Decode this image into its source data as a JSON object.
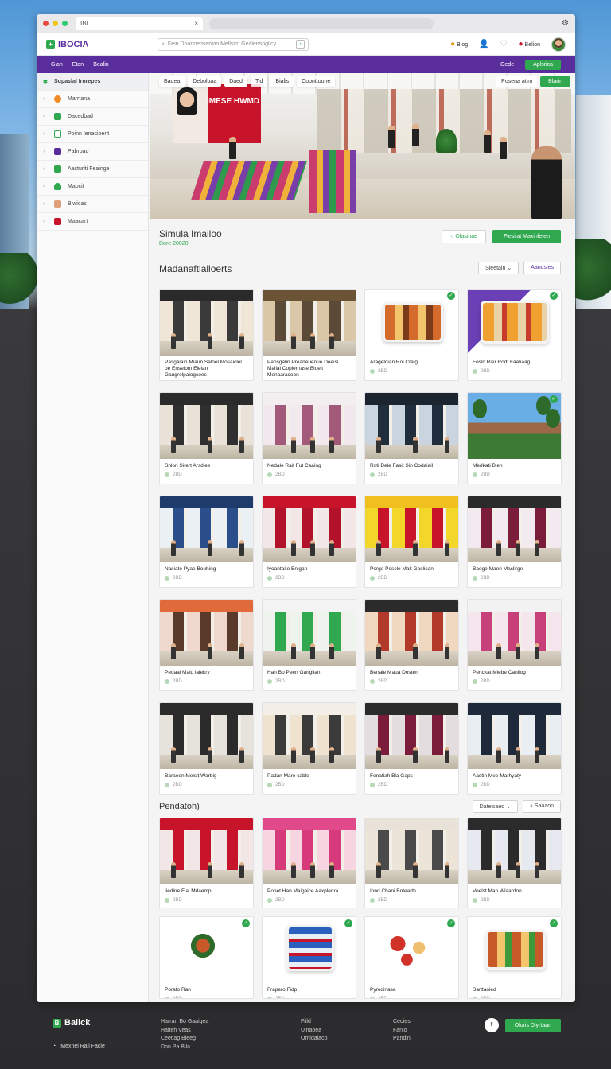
{
  "browser": {
    "tab_label": "IBl",
    "tab_close": "×",
    "settings_glyph": "⚙"
  },
  "appbar": {
    "logo": "IBOCIA",
    "search_placeholder": "Fein Dhanrienserwin Mellsirn Gealensnglicy",
    "user_name_1": "Blog",
    "user_name_2": "Belion"
  },
  "navbar": {
    "items": [
      "Gian",
      "Etan",
      "Bealin"
    ],
    "right_label": "Gede",
    "right_button": "Aplsrica"
  },
  "sidebar": {
    "items": [
      {
        "label": "Supaslal Irnrepes",
        "color": "#2fa84f"
      },
      {
        "label": "Marrtana",
        "color": "#f08a24"
      },
      {
        "label": "Dacedbad",
        "color": "#2fa84f"
      },
      {
        "label": "Poinn Ienacioent",
        "color": "#2fa84f"
      },
      {
        "label": "Pabroad",
        "color": "#5a2d9c"
      },
      {
        "label": "Aacturiti Feainge",
        "color": "#2fa84f"
      },
      {
        "label": "Maocit",
        "color": "#2fa84f"
      },
      {
        "label": "Biwicas",
        "color": "#c8142b"
      },
      {
        "label": "Maacart",
        "color": "#c8142b"
      }
    ]
  },
  "hero": {
    "tabs": [
      "Badea",
      "Debolbaa",
      "Daed",
      "Tid",
      "Bialis",
      "Coonttoone"
    ],
    "right_chip": "Posena atim",
    "right_button": "Blarin",
    "poster_text": "IMESE HWMD"
  },
  "section": {
    "title": "Simula Imailoo",
    "subtitle": "Dore 20020",
    "btn_outline": "Olasinae",
    "btn_solid": "Fiesilat Maxinleten"
  },
  "grid_head": {
    "title": "Madanaftlalloerts",
    "filter": "Sieetain",
    "right": "Aandsies"
  },
  "cards_a": [
    {
      "cap": "Pasgaiain Miaun Saloel Mosaiclel oe Enseiom Elelan Gaugrelpaiogcoes",
      "meta": "20D"
    },
    {
      "cap": "Paosgalin Preaneuenue Deeisi Maliai Coplernase Bioelt Menaaracoon",
      "meta": "2BD"
    },
    {
      "cap": "Arageldian Roi Craig",
      "meta": "2BD"
    },
    {
      "cap": "Fosin Rier Rodf Faatiaag",
      "meta": "2BD"
    },
    {
      "cap": "Snlon Sirert Arsdles",
      "meta": "2BD"
    },
    {
      "cap": "Nedale Rait Fut Caaing",
      "meta": "2BD"
    },
    {
      "cap": "Roti Dele Fasit Sin Codaiail",
      "meta": "2BD"
    },
    {
      "cap": "Medkati Blen",
      "meta": "2BD"
    },
    {
      "cap": "Nasiate Pyae Bouhing",
      "meta": "2BD"
    },
    {
      "cap": "Iyoantaite Enigan",
      "meta": "2BD"
    },
    {
      "cap": "Porgo Poscle Mak Goslican",
      "meta": "2BD"
    },
    {
      "cap": "Baoge Maen Maslirge",
      "meta": "2BD"
    },
    {
      "cap": "Pedaal Mald lalekry",
      "meta": "2BD"
    },
    {
      "cap": "Han Bo Peen Garigilan",
      "meta": "2BD"
    },
    {
      "cap": "Benale Maua Dosten",
      "meta": "2BD"
    },
    {
      "cap": "Penckat Mlebe Canliog",
      "meta": "2BD"
    },
    {
      "cap": "Baraeen Meisit Warbig",
      "meta": "2BD"
    },
    {
      "cap": "Padan Mare cable",
      "meta": "2BD"
    },
    {
      "cap": "Fenatiah Bla Gaps",
      "meta": "2BD"
    },
    {
      "cap": "Aastin Mee Marhyaty",
      "meta": "2BD"
    }
  ],
  "section2": {
    "title": "Pendatoh)",
    "filter": "Dateisaed",
    "search": "Saaaon"
  },
  "cards_b": [
    {
      "cap": "Iiedine Fial Mdaemp",
      "meta": "2BD"
    },
    {
      "cap": "Ponet Han Maigaice Aaxplenra",
      "meta": "2BD"
    },
    {
      "cap": "Iond Chani Botearth",
      "meta": "2BD"
    },
    {
      "cap": "Voelst Man Wlaardon",
      "meta": "2BD"
    },
    {
      "cap": "Porato Ran",
      "meta": "2BD"
    },
    {
      "cap": "Frapero Fidp",
      "meta": "2BD"
    },
    {
      "cap": "Pyrodinasa",
      "meta": "2BD"
    },
    {
      "cap": "Sarttaoied",
      "meta": "2BD"
    }
  ],
  "footer": {
    "logo": "Balick",
    "note": "Mexnel Rall Facle",
    "col1": [
      "Harran Bo Gaaiqea",
      "Halteh Veas",
      "Ceetiag Bieeg",
      "Dpn Pa Bila"
    ],
    "col2": [
      "Fiild",
      "Uinaoea",
      "Omidalaco"
    ],
    "col3": [
      "Ceoies",
      "Fanlo",
      "Pandin"
    ],
    "button": "Oloris Dlyrtaan"
  }
}
